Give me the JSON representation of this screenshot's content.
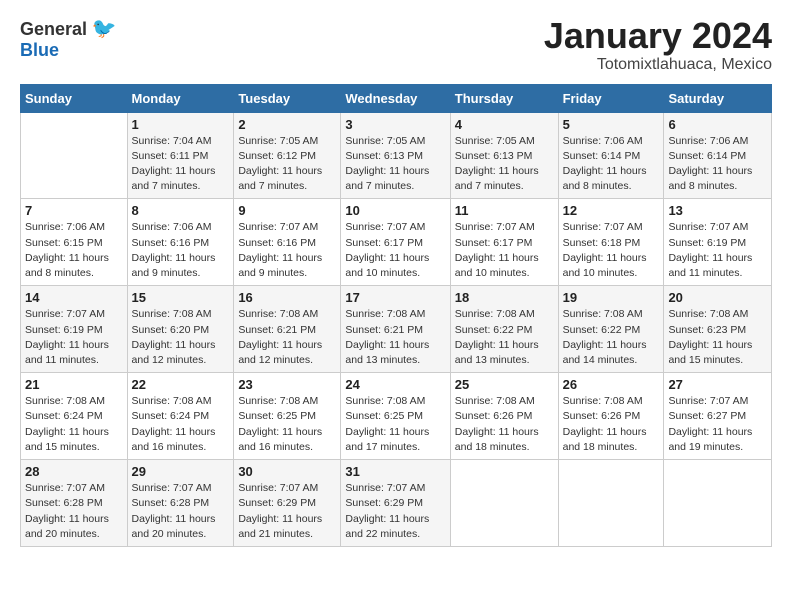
{
  "header": {
    "logo_general": "General",
    "logo_blue": "Blue",
    "title": "January 2024",
    "location": "Totomixtlahuaca, Mexico"
  },
  "weekdays": [
    "Sunday",
    "Monday",
    "Tuesday",
    "Wednesday",
    "Thursday",
    "Friday",
    "Saturday"
  ],
  "weeks": [
    [
      {
        "day": "",
        "sunrise": "",
        "sunset": "",
        "daylight": ""
      },
      {
        "day": "1",
        "sunrise": "Sunrise: 7:04 AM",
        "sunset": "Sunset: 6:11 PM",
        "daylight": "Daylight: 11 hours and 7 minutes."
      },
      {
        "day": "2",
        "sunrise": "Sunrise: 7:05 AM",
        "sunset": "Sunset: 6:12 PM",
        "daylight": "Daylight: 11 hours and 7 minutes."
      },
      {
        "day": "3",
        "sunrise": "Sunrise: 7:05 AM",
        "sunset": "Sunset: 6:13 PM",
        "daylight": "Daylight: 11 hours and 7 minutes."
      },
      {
        "day": "4",
        "sunrise": "Sunrise: 7:05 AM",
        "sunset": "Sunset: 6:13 PM",
        "daylight": "Daylight: 11 hours and 7 minutes."
      },
      {
        "day": "5",
        "sunrise": "Sunrise: 7:06 AM",
        "sunset": "Sunset: 6:14 PM",
        "daylight": "Daylight: 11 hours and 8 minutes."
      },
      {
        "day": "6",
        "sunrise": "Sunrise: 7:06 AM",
        "sunset": "Sunset: 6:14 PM",
        "daylight": "Daylight: 11 hours and 8 minutes."
      }
    ],
    [
      {
        "day": "7",
        "sunrise": "Sunrise: 7:06 AM",
        "sunset": "Sunset: 6:15 PM",
        "daylight": "Daylight: 11 hours and 8 minutes."
      },
      {
        "day": "8",
        "sunrise": "Sunrise: 7:06 AM",
        "sunset": "Sunset: 6:16 PM",
        "daylight": "Daylight: 11 hours and 9 minutes."
      },
      {
        "day": "9",
        "sunrise": "Sunrise: 7:07 AM",
        "sunset": "Sunset: 6:16 PM",
        "daylight": "Daylight: 11 hours and 9 minutes."
      },
      {
        "day": "10",
        "sunrise": "Sunrise: 7:07 AM",
        "sunset": "Sunset: 6:17 PM",
        "daylight": "Daylight: 11 hours and 10 minutes."
      },
      {
        "day": "11",
        "sunrise": "Sunrise: 7:07 AM",
        "sunset": "Sunset: 6:17 PM",
        "daylight": "Daylight: 11 hours and 10 minutes."
      },
      {
        "day": "12",
        "sunrise": "Sunrise: 7:07 AM",
        "sunset": "Sunset: 6:18 PM",
        "daylight": "Daylight: 11 hours and 10 minutes."
      },
      {
        "day": "13",
        "sunrise": "Sunrise: 7:07 AM",
        "sunset": "Sunset: 6:19 PM",
        "daylight": "Daylight: 11 hours and 11 minutes."
      }
    ],
    [
      {
        "day": "14",
        "sunrise": "Sunrise: 7:07 AM",
        "sunset": "Sunset: 6:19 PM",
        "daylight": "Daylight: 11 hours and 11 minutes."
      },
      {
        "day": "15",
        "sunrise": "Sunrise: 7:08 AM",
        "sunset": "Sunset: 6:20 PM",
        "daylight": "Daylight: 11 hours and 12 minutes."
      },
      {
        "day": "16",
        "sunrise": "Sunrise: 7:08 AM",
        "sunset": "Sunset: 6:21 PM",
        "daylight": "Daylight: 11 hours and 12 minutes."
      },
      {
        "day": "17",
        "sunrise": "Sunrise: 7:08 AM",
        "sunset": "Sunset: 6:21 PM",
        "daylight": "Daylight: 11 hours and 13 minutes."
      },
      {
        "day": "18",
        "sunrise": "Sunrise: 7:08 AM",
        "sunset": "Sunset: 6:22 PM",
        "daylight": "Daylight: 11 hours and 13 minutes."
      },
      {
        "day": "19",
        "sunrise": "Sunrise: 7:08 AM",
        "sunset": "Sunset: 6:22 PM",
        "daylight": "Daylight: 11 hours and 14 minutes."
      },
      {
        "day": "20",
        "sunrise": "Sunrise: 7:08 AM",
        "sunset": "Sunset: 6:23 PM",
        "daylight": "Daylight: 11 hours and 15 minutes."
      }
    ],
    [
      {
        "day": "21",
        "sunrise": "Sunrise: 7:08 AM",
        "sunset": "Sunset: 6:24 PM",
        "daylight": "Daylight: 11 hours and 15 minutes."
      },
      {
        "day": "22",
        "sunrise": "Sunrise: 7:08 AM",
        "sunset": "Sunset: 6:24 PM",
        "daylight": "Daylight: 11 hours and 16 minutes."
      },
      {
        "day": "23",
        "sunrise": "Sunrise: 7:08 AM",
        "sunset": "Sunset: 6:25 PM",
        "daylight": "Daylight: 11 hours and 16 minutes."
      },
      {
        "day": "24",
        "sunrise": "Sunrise: 7:08 AM",
        "sunset": "Sunset: 6:25 PM",
        "daylight": "Daylight: 11 hours and 17 minutes."
      },
      {
        "day": "25",
        "sunrise": "Sunrise: 7:08 AM",
        "sunset": "Sunset: 6:26 PM",
        "daylight": "Daylight: 11 hours and 18 minutes."
      },
      {
        "day": "26",
        "sunrise": "Sunrise: 7:08 AM",
        "sunset": "Sunset: 6:26 PM",
        "daylight": "Daylight: 11 hours and 18 minutes."
      },
      {
        "day": "27",
        "sunrise": "Sunrise: 7:07 AM",
        "sunset": "Sunset: 6:27 PM",
        "daylight": "Daylight: 11 hours and 19 minutes."
      }
    ],
    [
      {
        "day": "28",
        "sunrise": "Sunrise: 7:07 AM",
        "sunset": "Sunset: 6:28 PM",
        "daylight": "Daylight: 11 hours and 20 minutes."
      },
      {
        "day": "29",
        "sunrise": "Sunrise: 7:07 AM",
        "sunset": "Sunset: 6:28 PM",
        "daylight": "Daylight: 11 hours and 20 minutes."
      },
      {
        "day": "30",
        "sunrise": "Sunrise: 7:07 AM",
        "sunset": "Sunset: 6:29 PM",
        "daylight": "Daylight: 11 hours and 21 minutes."
      },
      {
        "day": "31",
        "sunrise": "Sunrise: 7:07 AM",
        "sunset": "Sunset: 6:29 PM",
        "daylight": "Daylight: 11 hours and 22 minutes."
      },
      {
        "day": "",
        "sunrise": "",
        "sunset": "",
        "daylight": ""
      },
      {
        "day": "",
        "sunrise": "",
        "sunset": "",
        "daylight": ""
      },
      {
        "day": "",
        "sunrise": "",
        "sunset": "",
        "daylight": ""
      }
    ]
  ]
}
